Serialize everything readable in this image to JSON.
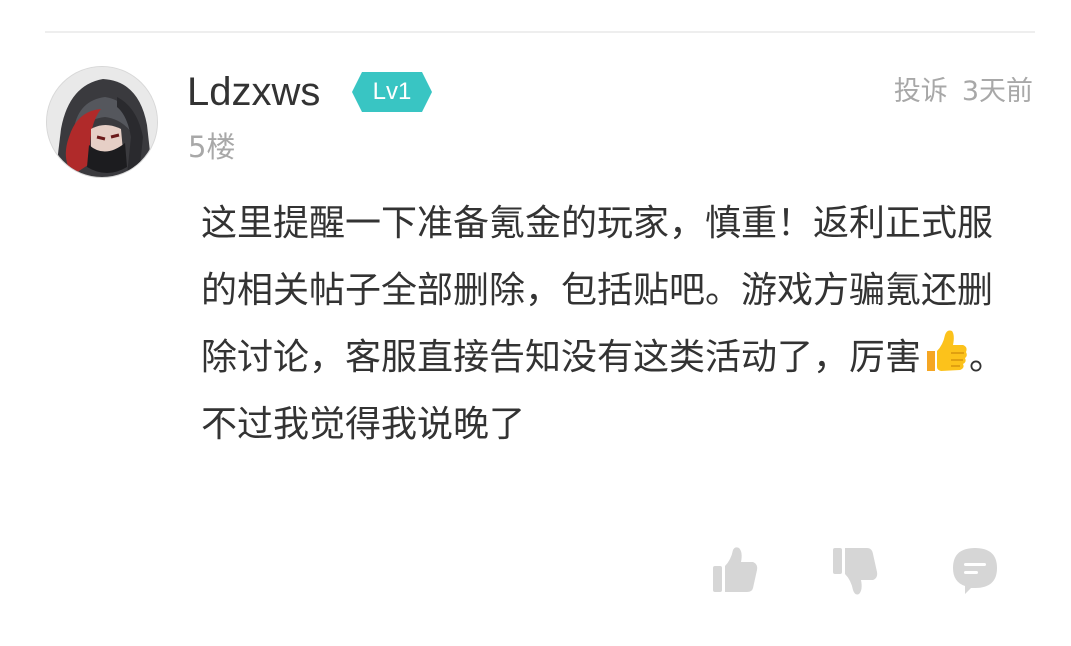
{
  "comment": {
    "username": "Ldzxws",
    "level": "Lv1",
    "floor": "5楼",
    "report_label": "投诉",
    "time": "3天前",
    "text_main": "这里提醒一下准备氪金的玩家，慎重！返利正式服的相关帖子全部删除，包括贴吧。游戏方骗氪还删除讨论，客服直接告知没有这类活动了，厉害",
    "text_main_end": "。",
    "text_second": "不过我觉得我说晚了"
  },
  "icons": {
    "avatar": "anime-character-avatar",
    "level_badge": "hexagon-badge",
    "emoji": "thumbs-up-emoji",
    "like": "thumb-up-icon",
    "dislike": "thumb-down-icon",
    "reply": "comment-bubble-icon"
  },
  "colors": {
    "level_badge": "#39c5c3",
    "text_primary": "#333333",
    "text_secondary": "#a8a8a8",
    "icon_gray": "#d6d6d6"
  }
}
